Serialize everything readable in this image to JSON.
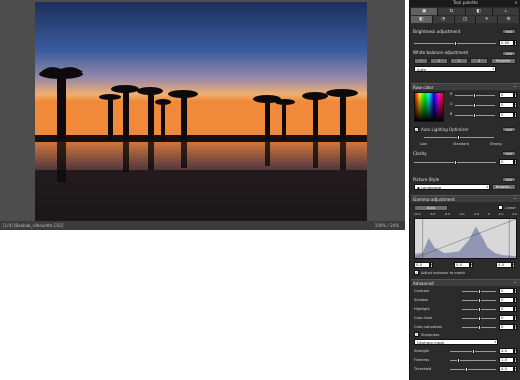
{
  "viewer": {
    "status_left": "[1/4] [Baobab_silhouette.CR2]",
    "status_right": "100% / 24%"
  },
  "panel": {
    "title": "Tool palette",
    "close": "×",
    "tabs_top": [
      "▣",
      "⇆",
      "◧",
      "⊥"
    ],
    "tabs_bottom": [
      "◧",
      "◔",
      "◫",
      "✳",
      "⚙"
    ],
    "brightness": {
      "label": "Brightness adjustment",
      "value": "0.00",
      "btn": "Init"
    },
    "white_balance": {
      "label": "White balance adjustment",
      "btn": "Init",
      "tool_buttons": [
        "⟋",
        "1",
        "2",
        "3"
      ],
      "register": "Register",
      "mode": "Auto"
    },
    "raw": {
      "label": "Raw color",
      "r": "R",
      "g": "G",
      "b": "B",
      "values": [
        "0",
        "0",
        "0"
      ]
    },
    "alo": {
      "label": "Auto Lighting Optimizer",
      "btn": "Init",
      "levels": [
        "Low",
        "Standard",
        "Strong"
      ]
    },
    "clarity": {
      "label": "Clarity",
      "value": "0",
      "btn": "Init"
    },
    "picture_style": {
      "label": "Picture Style",
      "btn": "Init",
      "value": "Landscape",
      "browse": "Browse..."
    },
    "gamma": {
      "label": "Gamma adjustment",
      "btn_auto": "Auto",
      "linear": "Linear",
      "scale": [
        "-10.0",
        "-8.0",
        "-6.0",
        "-4.0",
        "-2.0",
        "0",
        "2.0",
        "4.0"
      ],
      "lo": "0.0",
      "mid": "0.0",
      "hi": "4.0",
      "adjust_label": "Adjust indicator to match"
    },
    "advanced": {
      "label": "Advanced",
      "rows": [
        {
          "name": "Contrast",
          "value": "0"
        },
        {
          "name": "Shadow",
          "value": "0"
        },
        {
          "name": "Highlight",
          "value": "0"
        },
        {
          "name": "Color tone",
          "value": "0"
        },
        {
          "name": "Color saturation",
          "value": "0"
        }
      ]
    },
    "sharpness": {
      "label": "Sharpness",
      "mode": "Unsharp mask",
      "rows": [
        {
          "name": "Strength",
          "value": "4.0"
        },
        {
          "name": "Fineness",
          "value": "1.0"
        },
        {
          "name": "Threshold",
          "value": "4.0"
        }
      ]
    }
  },
  "colors": {
    "panel_bg": "#2b2b2b",
    "section_header": "#3e3e3e",
    "sky_top": "#1c3f7a",
    "horizon": "#f08a3a"
  }
}
